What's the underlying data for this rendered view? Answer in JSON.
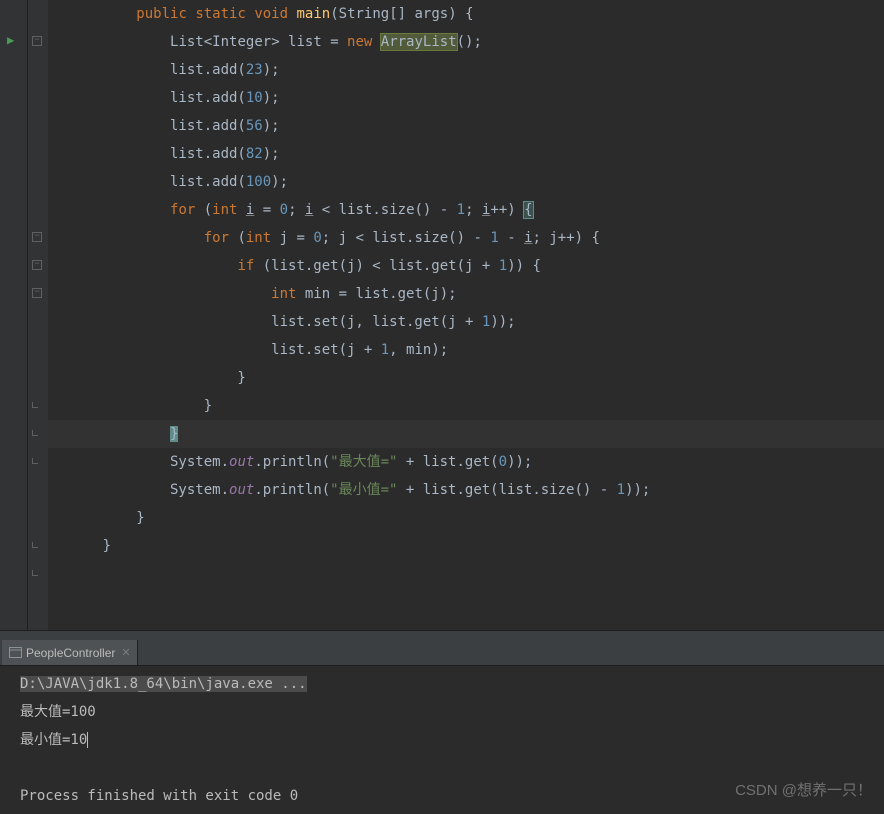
{
  "code": {
    "lines": [
      {
        "indent": 2,
        "tokens": [
          {
            "t": "public ",
            "c": "kw"
          },
          {
            "t": "static ",
            "c": "kw"
          },
          {
            "t": "void ",
            "c": "kw"
          },
          {
            "t": "main",
            "c": "method"
          },
          {
            "t": "(",
            "c": ""
          },
          {
            "t": "String",
            "c": "class-name"
          },
          {
            "t": "[] args) {",
            "c": ""
          }
        ]
      },
      {
        "indent": 3,
        "tokens": [
          {
            "t": "List",
            "c": "class-name"
          },
          {
            "t": "<",
            "c": ""
          },
          {
            "t": "Integer",
            "c": "class-name"
          },
          {
            "t": "> list = ",
            "c": ""
          },
          {
            "t": "new ",
            "c": "kw"
          },
          {
            "t": "ArrayList",
            "c": "boxed"
          },
          {
            "t": "();",
            "c": ""
          }
        ]
      },
      {
        "indent": 3,
        "tokens": [
          {
            "t": "list.add(",
            "c": ""
          },
          {
            "t": "23",
            "c": "num"
          },
          {
            "t": ");",
            "c": ""
          }
        ]
      },
      {
        "indent": 3,
        "tokens": [
          {
            "t": "list.add(",
            "c": ""
          },
          {
            "t": "10",
            "c": "num"
          },
          {
            "t": ");",
            "c": ""
          }
        ]
      },
      {
        "indent": 3,
        "tokens": [
          {
            "t": "list.add(",
            "c": ""
          },
          {
            "t": "56",
            "c": "num"
          },
          {
            "t": ");",
            "c": ""
          }
        ]
      },
      {
        "indent": 3,
        "tokens": [
          {
            "t": "list.add(",
            "c": ""
          },
          {
            "t": "82",
            "c": "num"
          },
          {
            "t": ");",
            "c": ""
          }
        ]
      },
      {
        "indent": 3,
        "tokens": [
          {
            "t": "list.add(",
            "c": ""
          },
          {
            "t": "100",
            "c": "num"
          },
          {
            "t": ");",
            "c": ""
          }
        ]
      },
      {
        "indent": 3,
        "tokens": [
          {
            "t": "for ",
            "c": "kw"
          },
          {
            "t": "(",
            "c": ""
          },
          {
            "t": "int ",
            "c": "kw"
          },
          {
            "t": "i",
            "c": "underline"
          },
          {
            "t": " = ",
            "c": ""
          },
          {
            "t": "0",
            "c": "num"
          },
          {
            "t": "; ",
            "c": ""
          },
          {
            "t": "i",
            "c": "underline"
          },
          {
            "t": " < list.size() - ",
            "c": ""
          },
          {
            "t": "1",
            "c": "num"
          },
          {
            "t": "; ",
            "c": ""
          },
          {
            "t": "i",
            "c": "underline"
          },
          {
            "t": "++) ",
            "c": ""
          },
          {
            "t": "{",
            "c": "bracket-match"
          }
        ]
      },
      {
        "indent": 4,
        "tokens": [
          {
            "t": "for ",
            "c": "kw"
          },
          {
            "t": "(",
            "c": ""
          },
          {
            "t": "int ",
            "c": "kw"
          },
          {
            "t": "j = ",
            "c": ""
          },
          {
            "t": "0",
            "c": "num"
          },
          {
            "t": "; j < list.size() - ",
            "c": ""
          },
          {
            "t": "1",
            "c": "num"
          },
          {
            "t": " - ",
            "c": ""
          },
          {
            "t": "i",
            "c": "underline"
          },
          {
            "t": "; j++) {",
            "c": ""
          }
        ]
      },
      {
        "indent": 5,
        "tokens": [
          {
            "t": "if ",
            "c": "kw"
          },
          {
            "t": "(list.get(j) < list.get(j + ",
            "c": ""
          },
          {
            "t": "1",
            "c": "num"
          },
          {
            "t": ")) {",
            "c": ""
          }
        ]
      },
      {
        "indent": 6,
        "tokens": [
          {
            "t": "int ",
            "c": "kw"
          },
          {
            "t": "min = list.get(j);",
            "c": ""
          }
        ]
      },
      {
        "indent": 6,
        "tokens": [
          {
            "t": "list.set(j, list.get(j + ",
            "c": ""
          },
          {
            "t": "1",
            "c": "num"
          },
          {
            "t": "));",
            "c": ""
          }
        ]
      },
      {
        "indent": 6,
        "tokens": [
          {
            "t": "list.set(j + ",
            "c": ""
          },
          {
            "t": "1",
            "c": "num"
          },
          {
            "t": ", min);",
            "c": ""
          }
        ]
      },
      {
        "indent": 5,
        "tokens": [
          {
            "t": "}",
            "c": ""
          }
        ]
      },
      {
        "indent": 4,
        "tokens": [
          {
            "t": "}",
            "c": ""
          }
        ]
      },
      {
        "indent": 3,
        "highlight": true,
        "tokens": [
          {
            "t": "}",
            "c": "caret-bracket"
          }
        ]
      },
      {
        "indent": 3,
        "tokens": [
          {
            "t": "System.",
            "c": ""
          },
          {
            "t": "out",
            "c": "field"
          },
          {
            "t": ".println(",
            "c": ""
          },
          {
            "t": "\"最大值=\"",
            "c": "str"
          },
          {
            "t": " + list.get(",
            "c": ""
          },
          {
            "t": "0",
            "c": "num"
          },
          {
            "t": "));",
            "c": ""
          }
        ]
      },
      {
        "indent": 3,
        "tokens": [
          {
            "t": "System.",
            "c": ""
          },
          {
            "t": "out",
            "c": "field"
          },
          {
            "t": ".println(",
            "c": ""
          },
          {
            "t": "\"最小值=\"",
            "c": "str"
          },
          {
            "t": " + list.get(list.size() - ",
            "c": ""
          },
          {
            "t": "1",
            "c": "num"
          },
          {
            "t": "));",
            "c": ""
          }
        ]
      },
      {
        "indent": 2,
        "tokens": [
          {
            "t": "}",
            "c": ""
          }
        ]
      },
      {
        "indent": 1,
        "tokens": [
          {
            "t": "}",
            "c": ""
          }
        ]
      },
      {
        "indent": 0,
        "tokens": []
      }
    ]
  },
  "fold_markers": [
    {
      "line": 0,
      "type": "open"
    },
    {
      "line": 7,
      "type": "open"
    },
    {
      "line": 8,
      "type": "open"
    },
    {
      "line": 9,
      "type": "open"
    },
    {
      "line": 13,
      "type": "close"
    },
    {
      "line": 14,
      "type": "close"
    },
    {
      "line": 15,
      "type": "close"
    },
    {
      "line": 18,
      "type": "close"
    },
    {
      "line": 19,
      "type": "close"
    }
  ],
  "tab": {
    "name": "PeopleController"
  },
  "console": {
    "cmd": "D:\\JAVA\\jdk1.8_64\\bin\\java.exe ...",
    "out1": "最大值=100",
    "out2": "最小值=10",
    "exit": "Process finished with exit code 0"
  },
  "watermark": "CSDN @想养一只！"
}
